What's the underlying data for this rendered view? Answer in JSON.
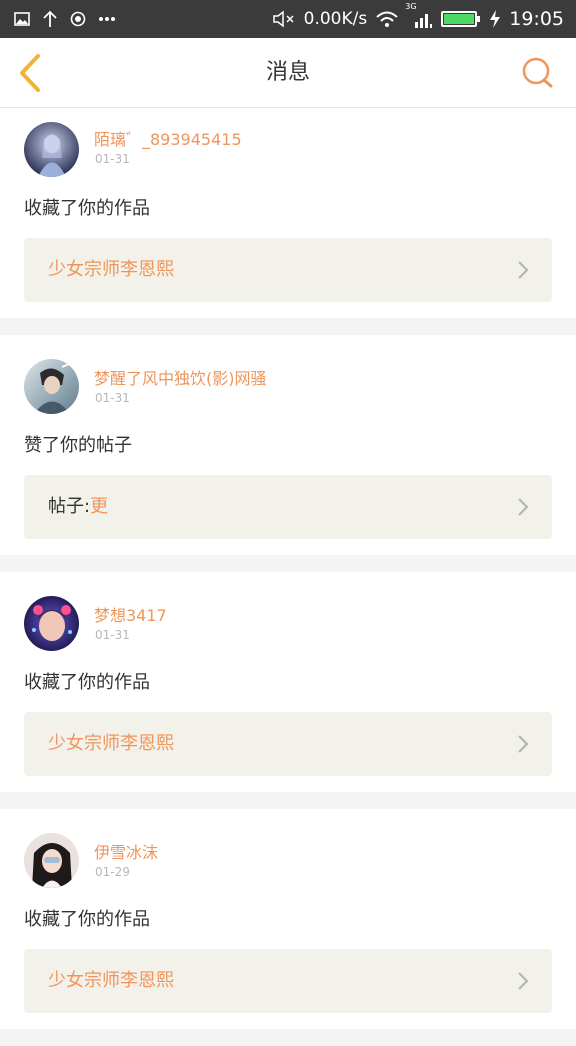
{
  "status_bar": {
    "network_speed": "0.00K/s",
    "network_type": "3G",
    "time": "19:05",
    "icons": [
      "image-icon",
      "upload-icon",
      "record-icon",
      "more-icon",
      "mute-icon",
      "wifi-icon",
      "signal-icon",
      "battery-icon",
      "charging-icon"
    ],
    "battery_level": 1.0
  },
  "header": {
    "title": "消息",
    "back_icon": "chevron-left-icon",
    "search_icon": "search-icon"
  },
  "colors": {
    "accent": "#f0955a",
    "back": "#f2b23a",
    "status_bar": "#3b3b3b",
    "work_box": "#f3f2ea"
  },
  "messages": [
    {
      "name": "陌璃゛_893945415",
      "time": "01-31",
      "action": "收藏了你的作品",
      "target_prefix": "",
      "target": "少女宗师李恩熙"
    },
    {
      "name": "梦醒了风中独饮(影)网骚",
      "time": "01-31",
      "action": "赞了你的帖子",
      "target_prefix": "帖子:",
      "target": "更"
    },
    {
      "name": "梦想3417",
      "time": "01-31",
      "action": "收藏了你的作品",
      "target_prefix": "",
      "target": "少女宗师李恩熙"
    },
    {
      "name": "伊雪冰沫",
      "time": "01-29",
      "action": "收藏了你的作品",
      "target_prefix": "",
      "target": "少女宗师李恩熙"
    }
  ]
}
